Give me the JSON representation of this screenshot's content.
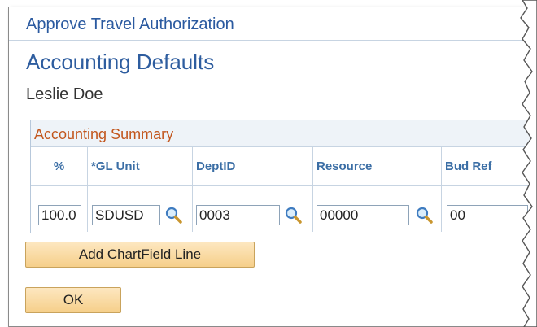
{
  "header": {
    "title": "Approve Travel Authorization"
  },
  "page": {
    "title": "Accounting Defaults",
    "person_name": "Leslie Doe"
  },
  "accounting_summary": {
    "title": "Accounting Summary",
    "columns": [
      "%",
      "*GL Unit",
      "DeptID",
      "Resource",
      "Bud Ref"
    ],
    "row": {
      "percent": "100.0",
      "gl_unit": "SDUSD",
      "dept_id": "0003",
      "resource": "00000",
      "bud_ref": "00"
    }
  },
  "buttons": {
    "add_chartfield_line": "Add ChartField Line",
    "ok": "OK"
  },
  "icons": {
    "lookup": "magnifier-lookup-icon"
  }
}
